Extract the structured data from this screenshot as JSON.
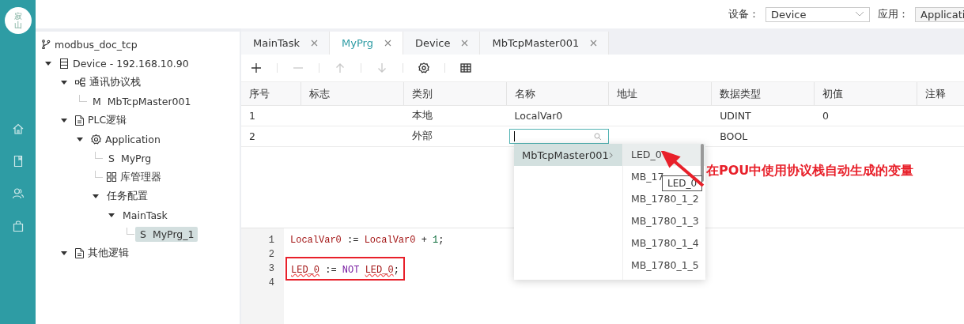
{
  "logo_text": "寂山",
  "rail": [
    {
      "kind": "home"
    },
    {
      "kind": "book"
    },
    {
      "kind": "users"
    },
    {
      "kind": "bag"
    }
  ],
  "header": {
    "device_label": "设备：",
    "device_value": "Device",
    "app_label": "应用：",
    "app_value": "Applicati"
  },
  "project": {
    "name": "modbus_doc_tcp"
  },
  "tree": [
    {
      "kind": "device",
      "label": "Device - 192.168.10.90",
      "expanded": true,
      "selected": false,
      "children": [
        {
          "kind": "protocol",
          "label": "通讯协议栈",
          "expanded": true,
          "selected": false,
          "children": [
            {
              "kind": "letter",
              "prefix": "M",
              "label": "MbTcpMaster001",
              "selected": false
            }
          ]
        },
        {
          "kind": "doc",
          "label": "PLC逻辑",
          "expanded": true,
          "selected": false,
          "children": [
            {
              "kind": "gear",
              "label": "Application",
              "expanded": true,
              "selected": false,
              "children": [
                {
                  "kind": "letter",
                  "prefix": "S",
                  "label": "MyPrg",
                  "selected": false
                },
                {
                  "kind": "grid",
                  "label": "库管理器",
                  "selected": false
                },
                {
                  "label": "任务配置",
                  "expanded": true,
                  "selected": false,
                  "children": [
                    {
                      "label": "MainTask",
                      "expanded": true,
                      "selected": false,
                      "children": [
                        {
                          "kind": "letter",
                          "prefix": "S",
                          "label": "MyPrg_1",
                          "selected": true
                        }
                      ]
                    }
                  ]
                }
              ]
            }
          ]
        },
        {
          "kind": "doc",
          "label": "其他逻辑",
          "expanded": true,
          "selected": false
        }
      ]
    }
  ],
  "tabs": [
    {
      "label": "MainTask",
      "selected": false
    },
    {
      "label": "MyPrg",
      "selected": true
    },
    {
      "label": "Device",
      "selected": false
    },
    {
      "label": "MbTcpMaster001",
      "selected": false
    }
  ],
  "toolbar": [
    {
      "kind": "add",
      "disabled": false
    },
    {
      "kind": "remove",
      "disabled": true
    },
    {
      "kind": "up",
      "disabled": true
    },
    {
      "kind": "down",
      "disabled": true
    },
    {
      "kind": "settings",
      "disabled": false
    },
    {
      "kind": "table",
      "disabled": false
    }
  ],
  "table": {
    "columns": [
      "序号",
      "标志",
      "类别",
      "名称",
      "地址",
      "数据类型",
      "初值",
      "注释"
    ],
    "rows": [
      {
        "cells": [
          "1",
          "",
          "本地",
          "LocalVar0",
          "",
          "UDINT",
          "0",
          ""
        ],
        "editing": false
      },
      {
        "cells": [
          "2",
          "",
          "外部",
          "",
          "",
          "BOOL",
          "",
          ""
        ],
        "editing": true
      }
    ]
  },
  "dropdown": {
    "groups": [
      {
        "label": "MbTcpMaster001",
        "selected": true
      }
    ],
    "items": [
      {
        "label": "LED_0",
        "selected": true
      },
      {
        "label": "MB_17",
        "selected": false
      },
      {
        "label": "MB_1780_1_2",
        "selected": false
      },
      {
        "label": "MB_1780_1_3",
        "selected": false
      },
      {
        "label": "MB_1780_1_4",
        "selected": false
      },
      {
        "label": "MB_1780_1_5",
        "selected": false
      }
    ],
    "tooltip": "LED_0"
  },
  "annotation": "在POU中使用协议栈自动生成的变量",
  "editor": {
    "lines": [
      {
        "number": "1",
        "tokens": [
          {
            "kind": "var",
            "text": "LocalVar0"
          },
          {
            "kind": "op",
            "text": " := "
          },
          {
            "kind": "var",
            "text": "LocalVar0"
          },
          {
            "kind": "op",
            "text": " + "
          },
          {
            "kind": "num",
            "text": "1"
          },
          {
            "kind": "op",
            "text": ";"
          }
        ]
      },
      {
        "number": "2"
      },
      {
        "number": "3",
        "highlighted": true,
        "tokens": [
          {
            "kind": "error",
            "text": "LED_0"
          },
          {
            "kind": "op",
            "text": " := "
          },
          {
            "kind": "keyword",
            "text": "NOT "
          },
          {
            "kind": "error",
            "text": "LED_0"
          },
          {
            "kind": "op",
            "text": ";"
          }
        ]
      },
      {
        "number": "4"
      }
    ]
  }
}
